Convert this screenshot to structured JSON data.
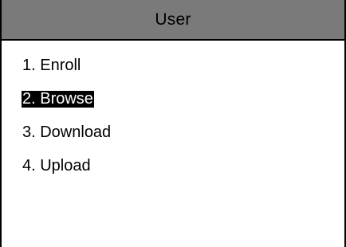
{
  "header": {
    "title": "User"
  },
  "menu": {
    "selected_index": 1,
    "items": [
      {
        "label": "1. Enroll"
      },
      {
        "label": "2. Browse"
      },
      {
        "label": "3. Download"
      },
      {
        "label": "4. Upload"
      }
    ]
  },
  "colors": {
    "title_bar": "#7a7a7a",
    "highlight_bg": "#000000",
    "highlight_text": "#ffffff",
    "background": "#ffffff"
  }
}
